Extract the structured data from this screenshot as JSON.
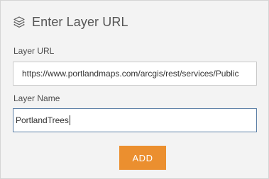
{
  "dialog": {
    "title": "Enter Layer URL",
    "icon": "layers-icon"
  },
  "layer_url": {
    "label": "Layer URL",
    "value": "https://www.portlandmaps.com/arcgis/rest/services/Public"
  },
  "layer_name": {
    "label": "Layer Name",
    "value": "PortlandTrees"
  },
  "actions": {
    "add_label": "ADD"
  },
  "colors": {
    "accent": "#eb8f2f",
    "focus_border": "#5b7fa6",
    "panel_bg": "#f3f3f3"
  }
}
